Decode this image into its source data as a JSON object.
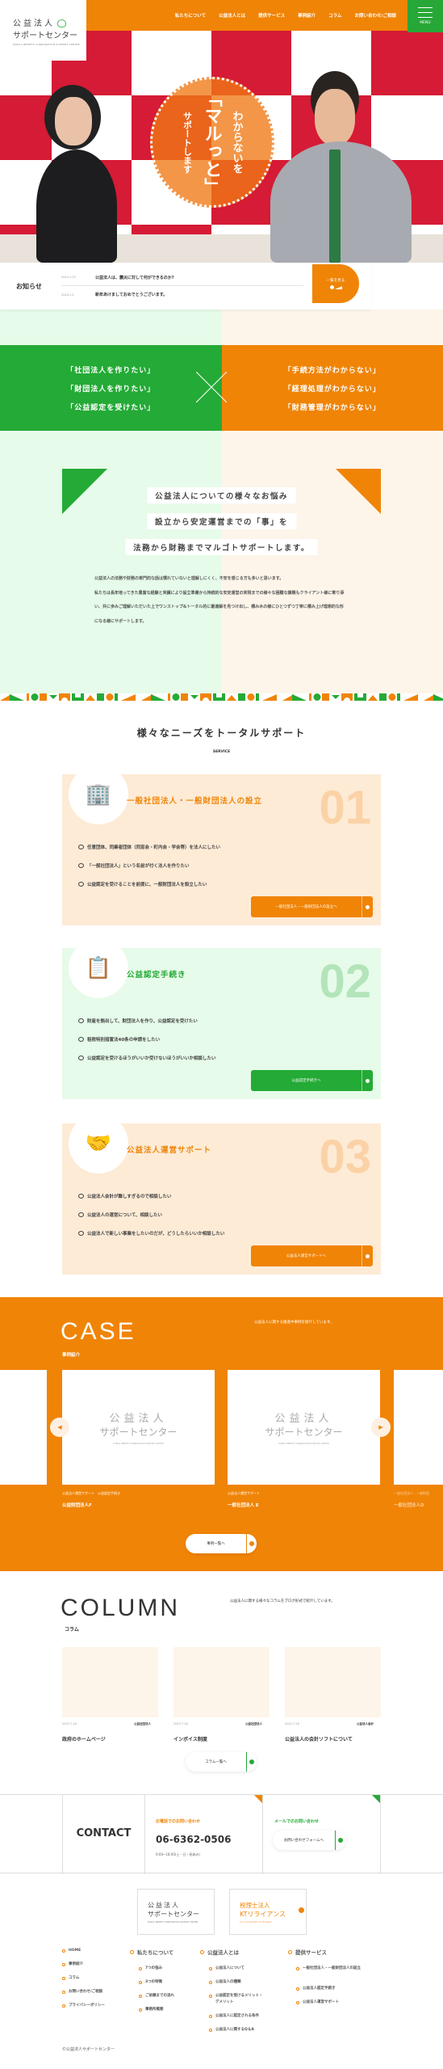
{
  "colors": {
    "orange": "#f08406",
    "green": "#24aa36",
    "light_green": "#e6fbe9",
    "light_orange": "#fdf5ea",
    "hero_red": "#d51b35"
  },
  "logo": {
    "line1": "公益法人",
    "line2": "サポートセンター",
    "line3": "PUBLIC BENEFIT CORPORATION SUPPORT CENTER",
    "icon": "heart-handshake-icon"
  },
  "nav": {
    "items": [
      "私たちについて",
      "公益法人とは",
      "提供サービス",
      "事例紹介",
      "コラム",
      "お問い合わせ/ご相談"
    ],
    "menu_label": "MENU"
  },
  "hero": {
    "catch_1": "わからないを",
    "catch_2": "「マルっと」",
    "catch_3": "サポートします"
  },
  "news": {
    "title": "お知らせ",
    "items": [
      {
        "date": "2024.1.23",
        "text": "公益法人は、震災に対して何ができるのか?"
      },
      {
        "date": "2024.1.4",
        "text": "新年あけましておめでとうございます。"
      }
    ],
    "more": "一覧を見る"
  },
  "worries": {
    "left": [
      "「社団法人を作りたい」",
      "「財団法人を作りたい」",
      "「公益認定を受けたい」"
    ],
    "right": [
      "「手続方法がわからない」",
      "「経理処理がわからない」",
      "「財務管理がわからない」"
    ]
  },
  "intro": {
    "headlines": [
      "公益法人についての様々なお悩み",
      "設立から安定運営までの「事」を",
      "法務から財務までマルゴトサポートします。"
    ],
    "paragraph_1": "公益法人の法務や財務の専門的な話は慣れていないと理解しにくく、不安を感じる方も多いと思います。",
    "paragraph_2": "私たちは長年培ってきた豊富な経験と実績により設立準備から持続的な安定運営の実現までの様々な困難な課題もクライアント様に寄り添い、共に歩みご理解いただいた上でワンストップ&トータル的に最適解を見つけ出し、積み木の様にひとつずつ丁寧に積み上げ理想的な形になる様にサポートします。"
  },
  "service": {
    "title": "様々なニーズをトータルサポート",
    "subtitle": "SERVICE",
    "cards": [
      {
        "num": "01",
        "title": "一般社団法人・一般財団法人の設立",
        "icon": "building-people-icon",
        "items": [
          "任意団体、同業者団体（同窓会・町内会・学会等）を法人にしたい",
          "「一般社団法人」という名前が付く法人を作りたい",
          "公益認定を受けることを前提に、一般財団法人を設立したい"
        ],
        "button": "一般社団法人・一般財団法人の設立へ"
      },
      {
        "num": "02",
        "title": "公益認定手続き",
        "icon": "document-check-icon",
        "items": [
          "財産を拠出して、財団法人を作り、公益認定を受けたい",
          "租税特別措置法40条の申請をしたい",
          "公益認定を受けるほうがいいか受けないほうがいいか相談したい"
        ],
        "button": "公益認定手続きへ"
      },
      {
        "num": "03",
        "title": "公益法人運営サポート",
        "icon": "handshake-gear-icon",
        "items": [
          "公益法人会計が難しすぎるので相談したい",
          "公益法人の運営について、相談したい",
          "公益法人で新しい事業をしたいのだが、どうしたらいいか相談したい"
        ],
        "button": "公益法人運営サポートへ"
      }
    ]
  },
  "case": {
    "title": "CASE",
    "subtitle": "事例紹介",
    "description": "公益法人に関する推進中事例を紹介しています。",
    "items": [
      {
        "tags": "公益法人運営サポート　公益認定手続き",
        "name": "公益財団法人F"
      },
      {
        "tags": "公益法人運営サポート",
        "name": "一般社団法人 E"
      },
      {
        "tags": "一般社団法人・一般財団",
        "name": "一般社団法人D"
      }
    ],
    "button": "事例一覧へ"
  },
  "column": {
    "title": "COLUMN",
    "subtitle": "コラム",
    "description": "公益法人に関する様々なコラムをブログ形式で紹介しています。",
    "items": [
      {
        "date": "2023.7.26",
        "category": "公益社団法人",
        "title": "政府のホームページ"
      },
      {
        "date": "2023.7.26",
        "category": "公益社団法人",
        "title": "インボイス制度"
      },
      {
        "date": "2023.7.26",
        "category": "公益法人会計",
        "title": "公益法人の会計ソフトについて"
      }
    ],
    "button": "コラム一覧へ"
  },
  "contact": {
    "title": "CONTACT",
    "phone_label": "お電話でのお問い合わせ",
    "phone": "06-6362-0506",
    "hours": "9:00~18:00(土・日・祝休み)",
    "mail_label": "メールでのお問い合わせ",
    "mail_button": "お問い合わせフォームへ"
  },
  "footer": {
    "partner_line1": "税理士法人",
    "partner_line2": "KTリライアンス",
    "partner_line3": "TAX ACCOUNTANT KT RELIANCE",
    "col1": [
      "HOME",
      "事例紹介",
      "コラム",
      "お問い合わせ/ご相談",
      "プライバシーポリシー"
    ],
    "col2_title": "私たちについて",
    "col2": [
      "7つの強み",
      "3つの特徴",
      "ご依頼までの流れ",
      "事務所概要"
    ],
    "col3_title": "公益法人とは",
    "col3": [
      "公益法人について",
      "公益法人の種類",
      "公益認定を受けるメリット・デメリット",
      "公益法人に認定される条件",
      "公益法人に関するQ＆A"
    ],
    "col4_title": "提供サービス",
    "col4": [
      "一般社団法人・一般財団法人の設立",
      "公益法人認定手続き",
      "公益法人運営サポート"
    ],
    "copyright": "©公益法人サポートセンター"
  }
}
